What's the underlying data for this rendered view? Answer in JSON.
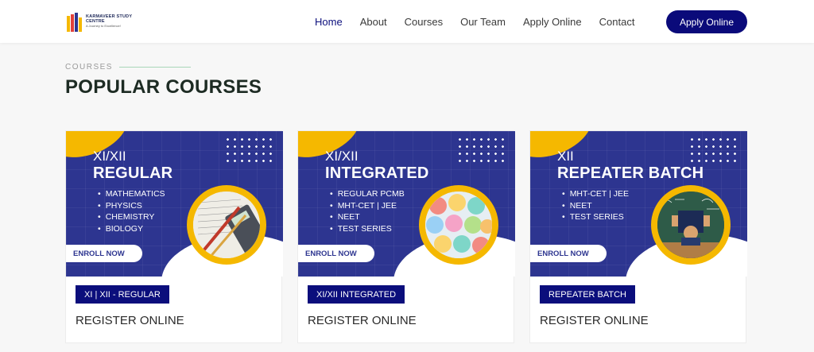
{
  "brand": {
    "name": "KARMAVEER STUDY CENTRE",
    "tagline": "A Journey to Excellence!"
  },
  "nav": {
    "items": [
      {
        "label": "Home",
        "active": true
      },
      {
        "label": "About"
      },
      {
        "label": "Courses"
      },
      {
        "label": "Our Team"
      },
      {
        "label": "Apply Online"
      },
      {
        "label": "Contact"
      }
    ],
    "cta_label": "Apply Online"
  },
  "section": {
    "label": "COURSES",
    "title": "POPULAR COURSES"
  },
  "courses": [
    {
      "grade": "XI/XII",
      "name": "REGULAR",
      "subjects": [
        "MATHEMATICS",
        "PHYSICS",
        "CHEMISTRY",
        "BIOLOGY"
      ],
      "enroll_label": "ENROLL NOW",
      "badge": "XI | XII - REGULAR",
      "register_label": "REGISTER ONLINE"
    },
    {
      "grade": "XI/XII",
      "name": "INTEGRATED",
      "subjects": [
        "REGULAR PCMB",
        "MHT-CET | JEE",
        "NEET",
        "TEST SERIES"
      ],
      "enroll_label": "ENROLL NOW",
      "badge": "XI/XII INTEGRATED",
      "register_label": "REGISTER ONLINE"
    },
    {
      "grade": "XII",
      "name": "REPEATER BATCH",
      "subjects": [
        "MHT-CET | JEE",
        "NEET",
        "TEST SERIES"
      ],
      "enroll_label": "ENROLL NOW",
      "badge": "REPEATER BATCH",
      "register_label": "REGISTER ONLINE"
    }
  ],
  "colors": {
    "brand_navy": "#0b0e7c",
    "banner_blue": "#2d3590",
    "accent_yellow": "#f5b800",
    "heading_dark": "#1d2b23"
  }
}
